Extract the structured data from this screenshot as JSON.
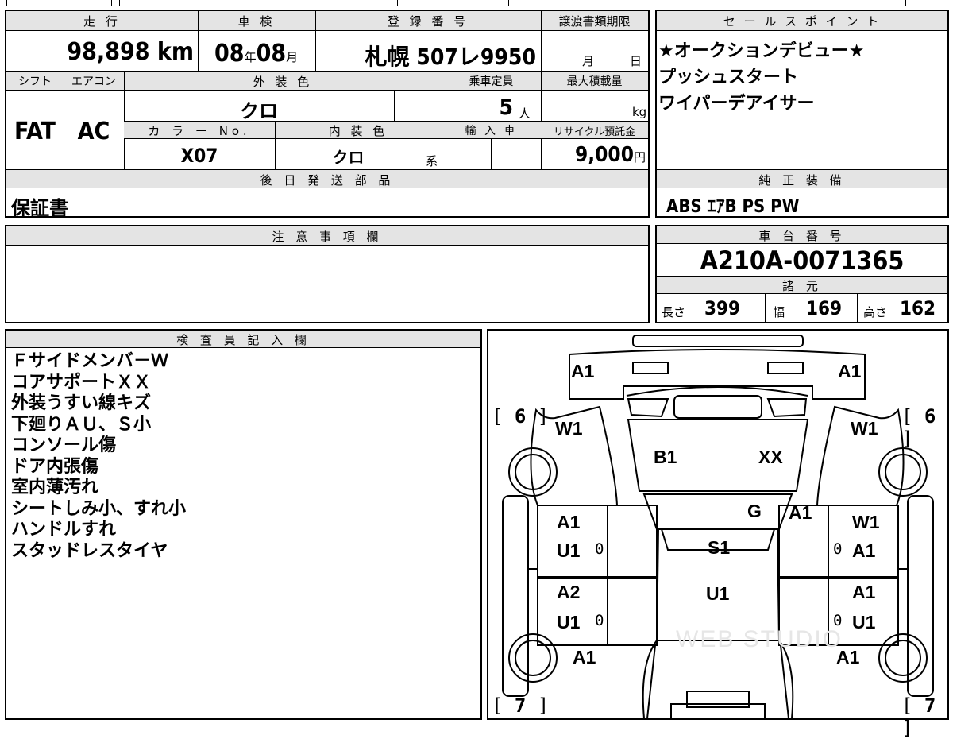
{
  "labels": {
    "mileage": "走 行",
    "inspection": "車 検",
    "registration": "登 録 番 号",
    "transfer_deadline": "譲渡書類期限",
    "shift": "シフト",
    "aircon": "エアコン",
    "exterior_color": "外 装 色",
    "capacity": "乗車定員",
    "max_load": "最大積載量",
    "color_no": "カ ラ ー No.",
    "interior_color": "内 装 色",
    "import": "輸 入 車",
    "recycle_fee": "リサイクル預託金",
    "later_parts": "後 日 発 送 部 品",
    "notes": "注 意 事 項 欄",
    "sales_points": "セ ー ル ス ポ イ ン ト",
    "standard_equipment": "純 正 装 備",
    "chassis_number": "車 台 番 号",
    "specs": "諸 元",
    "inspector_notes": "検 査 員 記 入 欄"
  },
  "vehicle": {
    "mileage": "98,898",
    "mileage_unit": "km",
    "inspection_year": "08",
    "inspection_year_unit": "年",
    "inspection_month": "08",
    "inspection_month_unit": "月",
    "registration": "札幌 507レ9950",
    "transfer_month_unit": "月",
    "transfer_day_unit": "日",
    "shift": "FAT",
    "aircon": "AC",
    "exterior_color": "クロ",
    "capacity": "5",
    "capacity_unit": "人",
    "max_load_unit": "kg",
    "color_no": "X07",
    "interior_color": "クロ",
    "interior_color_suffix": "系",
    "recycle_fee": "9,000",
    "recycle_fee_unit": "円",
    "later_parts": "保証書",
    "chassis_number": "A210A-0071365",
    "standard_equipment": "ABS ｴｱB PS PW"
  },
  "specs": {
    "length_label": "長さ",
    "length": "399",
    "width_label": "幅",
    "width": "169",
    "height_label": "高さ",
    "height": "162"
  },
  "sales_points": [
    "★オークションデビュー★",
    "プッシュスタート",
    "ワイパーデアイサー"
  ],
  "inspector_notes": [
    "Ｆサイドメンバ－Ｗ",
    "コアサポートＸＸ",
    "外装うすい線キズ",
    "下廻りＡＵ、Ｓ小",
    "コンソール傷",
    "ドア内張傷",
    "室内薄汚れ",
    "シートしみ小、すれ小",
    "ハンドルすれ",
    "スタッドレスタイヤ"
  ],
  "diagram": {
    "tire_front_left": "6",
    "tire_front_right": "6",
    "tire_rear_left": "7",
    "tire_rear_right": "7",
    "front_left": "A1",
    "front_right": "A1",
    "fender_front_left": "W1",
    "fender_front_right": "W1",
    "hood_left": "B1",
    "hood_right": "XX",
    "windshield": "G",
    "pillar_right": "A1",
    "front_door_left_top": "A1",
    "front_door_left_bottom": "U1",
    "front_door_left_mark": "0",
    "front_door_right_top": "W1",
    "front_door_right_bottom": "A1",
    "front_door_right_mark": "0",
    "roof": "S1",
    "floor": "U1",
    "rear_door_left_top": "A2",
    "rear_door_left_bottom": "U1",
    "rear_door_left_mark": "0",
    "rear_door_right_top": "A1",
    "rear_door_right_bottom": "U1",
    "rear_door_right_mark": "0",
    "rear_fender_left": "A1",
    "rear_fender_right": "A1",
    "watermark": "WEB STUDIO"
  }
}
